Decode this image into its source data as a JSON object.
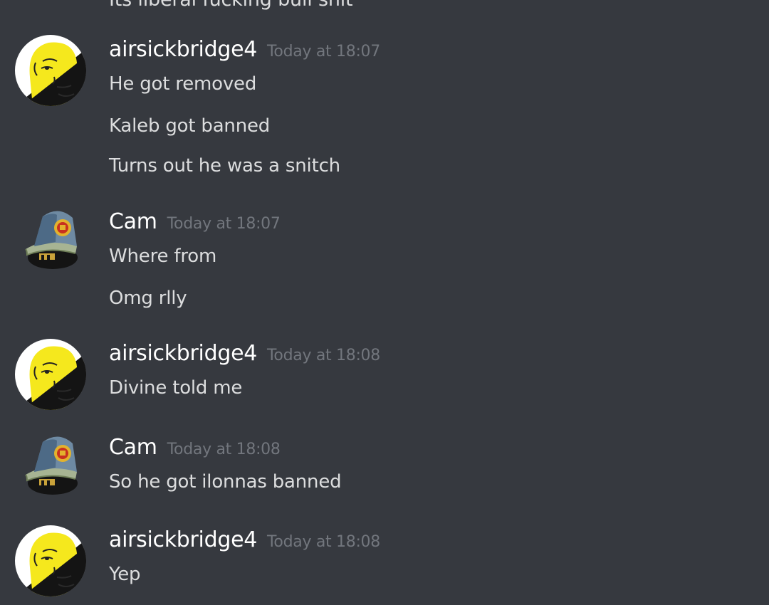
{
  "cut_message": "Its liberal fucking bull shit",
  "groups": [
    {
      "author": "airsickbridge4",
      "avatar": "wojak-ancap-avatar-icon",
      "timestamp": "Today at 18:07",
      "messages": [
        "He got removed",
        "Kaleb got banned",
        "Turns out he was a snitch"
      ]
    },
    {
      "author": "Cam",
      "avatar": "countryball-officer-avatar-icon",
      "timestamp": "Today at 18:07",
      "messages": [
        "Where from",
        "Omg rlly"
      ]
    },
    {
      "author": "airsickbridge4",
      "avatar": "wojak-ancap-avatar-icon",
      "timestamp": "Today at 18:08",
      "messages": [
        "Divine told me"
      ]
    },
    {
      "author": "Cam",
      "avatar": "countryball-officer-avatar-icon",
      "timestamp": "Today at 18:08",
      "messages": [
        "So he got ilonnas banned"
      ]
    },
    {
      "author": "airsickbridge4",
      "avatar": "wojak-ancap-avatar-icon",
      "timestamp": "Today at 18:08",
      "messages": [
        "Yep"
      ]
    }
  ],
  "colors": {
    "background": "#36393f",
    "username": "#ffffff",
    "timestamp": "#72767d",
    "message_text": "#dcddde",
    "ancap_yellow": "#f5e81d",
    "ancap_black": "#141414"
  }
}
